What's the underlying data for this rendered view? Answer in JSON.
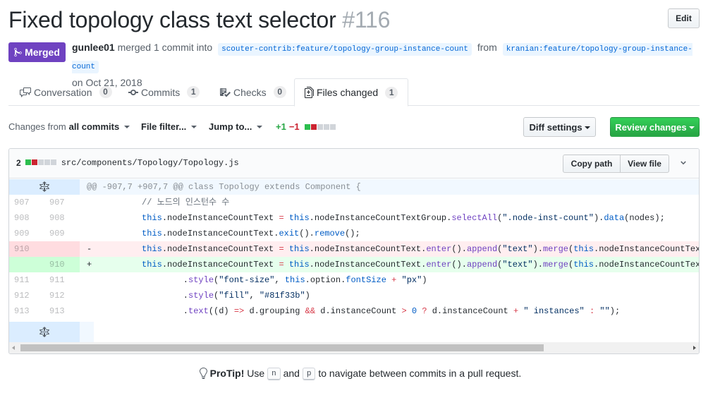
{
  "header": {
    "title": "Fixed topology class text selector",
    "number": "#116",
    "edit_label": "Edit"
  },
  "meta": {
    "state_label": "Merged",
    "state_color": "#6f42c1",
    "author": "gunlee01",
    "action_text": "merged 1 commit into",
    "base_branch": "scouter-contrib:feature/topology-group-instance-count",
    "from_text": "from",
    "head_branch": "kranian:feature/topology-group-instance-count",
    "date_text": "on Oct 21, 2018"
  },
  "tabs": [
    {
      "label": "Conversation",
      "count": "0",
      "icon": "comment-discussion-icon",
      "selected": false
    },
    {
      "label": "Commits",
      "count": "1",
      "icon": "git-commit-icon",
      "selected": false
    },
    {
      "label": "Checks",
      "count": "0",
      "icon": "checklist-icon",
      "selected": false
    },
    {
      "label": "Files changed",
      "count": "1",
      "icon": "file-diff-icon",
      "selected": true
    }
  ],
  "toolbar": {
    "changes_from_prefix": "Changes from",
    "changes_from_value": "all commits",
    "file_filter": "File filter...",
    "jump_to": "Jump to...",
    "additions": "+1",
    "deletions": "−1",
    "diff_settings": "Diff settings",
    "review_changes": "Review changes",
    "accent_green": "#28a745",
    "accent_red": "#cb2431"
  },
  "file": {
    "change_count": "2",
    "path": "src/components/Topology/Topology.js",
    "copy_path": "Copy path",
    "view_file": "View file",
    "hunk_header": "@@ -907,7 +907,7 @@ class Topology extends Component {",
    "lines": [
      {
        "type": "ctx",
        "old": "907",
        "new": "907",
        "marker": " ",
        "code": "        // 노드의 인스턴수 수"
      },
      {
        "type": "ctx",
        "old": "908",
        "new": "908",
        "marker": " ",
        "code": "        this.nodeInstanceCountText = this.nodeInstanceCountTextGroup.selectAll(\".node-inst-count\").data(nodes);"
      },
      {
        "type": "ctx",
        "old": "909",
        "new": "909",
        "marker": " ",
        "code": "        this.nodeInstanceCountText.exit().remove();"
      },
      {
        "type": "del",
        "old": "910",
        "new": "",
        "marker": "-",
        "code": "        this.nodeInstanceCountText = this.nodeInstanceCountText.enter().append(\"text\").merge(this.nodeInstanceCountTex"
      },
      {
        "type": "add",
        "old": "",
        "new": "910",
        "marker": "+",
        "code": "        this.nodeInstanceCountText = this.nodeInstanceCountText.enter().append(\"text\").merge(this.nodeInstanceCountTex"
      },
      {
        "type": "ctx",
        "old": "911",
        "new": "911",
        "marker": " ",
        "code": "            .style(\"font-size\", this.option.fontSize + \"px\")"
      },
      {
        "type": "ctx",
        "old": "912",
        "new": "912",
        "marker": " ",
        "code": "            .style(\"fill\", \"#81f33b\")"
      },
      {
        "type": "ctx",
        "old": "913",
        "new": "913",
        "marker": " ",
        "code": "            .text((d) => d.grouping && d.instanceCount > 0 ? d.instanceCount + \" instances\" : \"\");"
      }
    ]
  },
  "protip": {
    "label": "ProTip!",
    "text_before": "Use",
    "key1": "n",
    "text_mid": "and",
    "key2": "p",
    "text_after": "to navigate between commits in a pull request."
  }
}
